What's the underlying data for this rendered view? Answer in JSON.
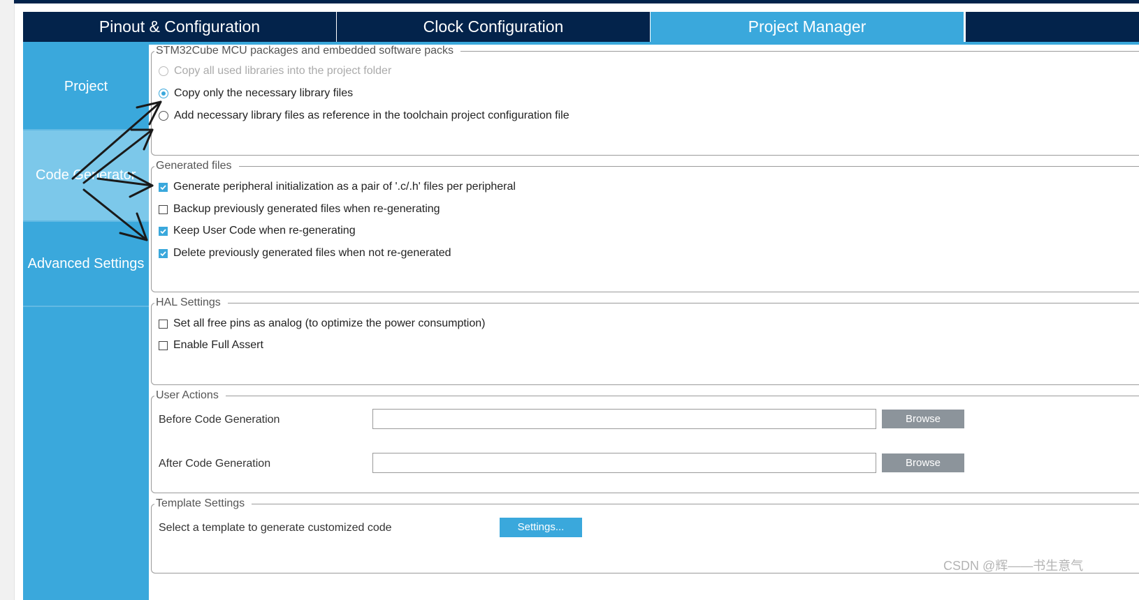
{
  "tabs": [
    {
      "label": "Pinout & Configuration",
      "active": false
    },
    {
      "label": "Clock Configuration",
      "active": false
    },
    {
      "label": "Project Manager",
      "active": true
    }
  ],
  "sidebar": {
    "items": [
      {
        "label": "Project",
        "active": false
      },
      {
        "label": "Code Generator",
        "active": true
      },
      {
        "label": "Advanced Settings",
        "active": false
      }
    ]
  },
  "packs": {
    "legend": "STM32Cube MCU packages and embedded software packs",
    "options": [
      {
        "label": "Copy all used libraries into the project folder",
        "selected": false,
        "enabled": false
      },
      {
        "label": "Copy only the necessary library files",
        "selected": true,
        "enabled": true
      },
      {
        "label": "Add necessary library files as reference in the toolchain project configuration file",
        "selected": false,
        "enabled": true
      }
    ]
  },
  "generated": {
    "legend": "Generated files",
    "options": [
      {
        "label": "Generate peripheral initialization as a pair of '.c/.h' files per peripheral",
        "checked": true
      },
      {
        "label": "Backup previously generated files when re-generating",
        "checked": false
      },
      {
        "label": "Keep User Code when re-generating",
        "checked": true
      },
      {
        "label": "Delete previously generated files when not re-generated",
        "checked": true
      }
    ]
  },
  "hal": {
    "legend": "HAL Settings",
    "options": [
      {
        "label": "Set all free pins as analog (to optimize the power consumption)",
        "checked": false
      },
      {
        "label": "Enable Full Assert",
        "checked": false
      }
    ]
  },
  "user_actions": {
    "legend": "User Actions",
    "before_label": "Before Code Generation",
    "before_value": "",
    "after_label": "After Code Generation",
    "after_value": "",
    "browse_label": "Browse"
  },
  "template": {
    "legend": "Template Settings",
    "label": "Select a template to generate customized code",
    "button": "Settings..."
  },
  "watermark": "CSDN @辉——书生意气",
  "colors": {
    "navy": "#03234b",
    "accent": "#3aa8dc",
    "sidebar_active": "#7cc8ea",
    "button_gray": "#8c949b"
  }
}
